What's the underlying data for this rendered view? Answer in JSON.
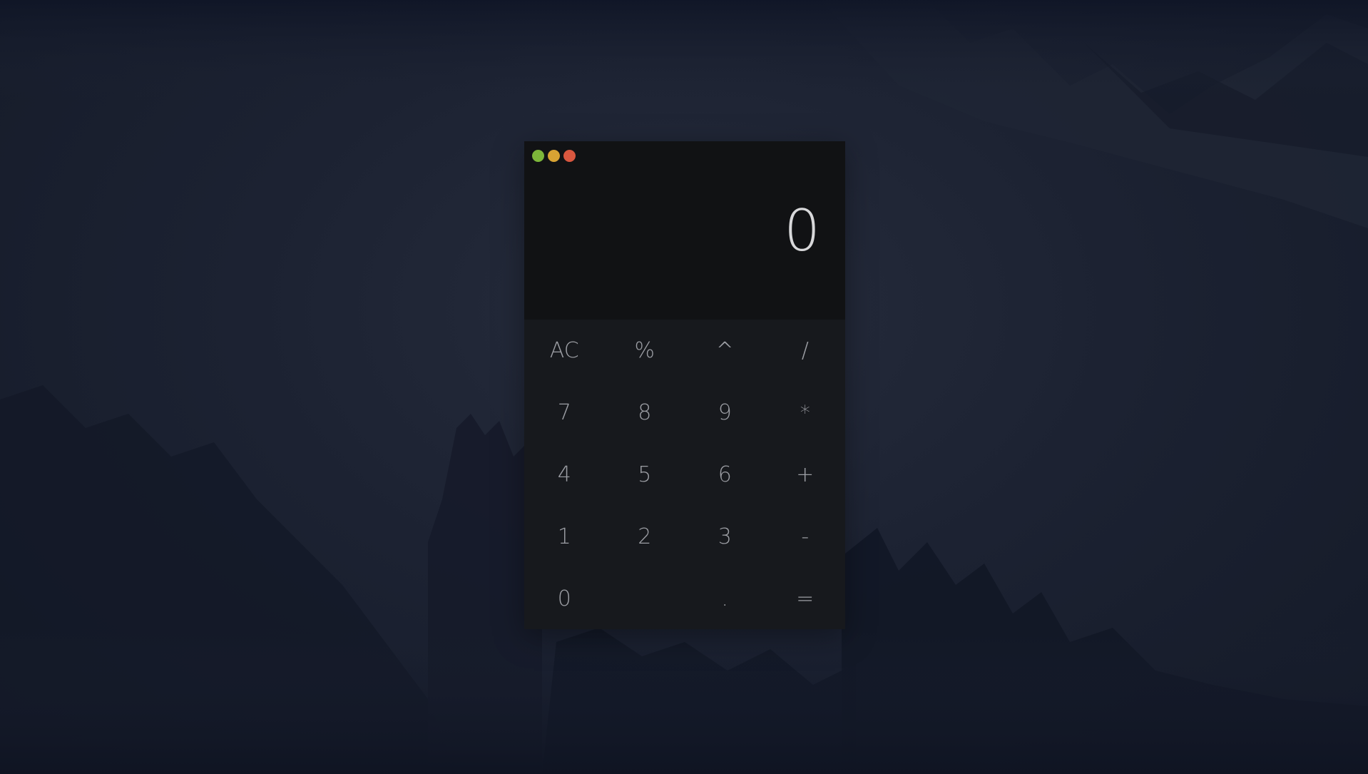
{
  "window": {
    "controls": [
      {
        "name": "maximize",
        "color": "#7db63a"
      },
      {
        "name": "minimize",
        "color": "#d8a333"
      },
      {
        "name": "close",
        "color": "#d9573f"
      }
    ]
  },
  "display": {
    "value": "0"
  },
  "keypad": {
    "rows": [
      [
        "AC",
        "%",
        "^",
        "/"
      ],
      [
        "7",
        "8",
        "9",
        "*"
      ],
      [
        "4",
        "5",
        "6",
        "+"
      ],
      [
        "1",
        "2",
        "3",
        "-"
      ],
      [
        "0",
        "",
        ".",
        "="
      ]
    ]
  },
  "colors": {
    "display_bg": "#111214",
    "keypad_bg": "#17191d",
    "key_text": "#9c9ea4",
    "display_text": "#d8d8da"
  }
}
